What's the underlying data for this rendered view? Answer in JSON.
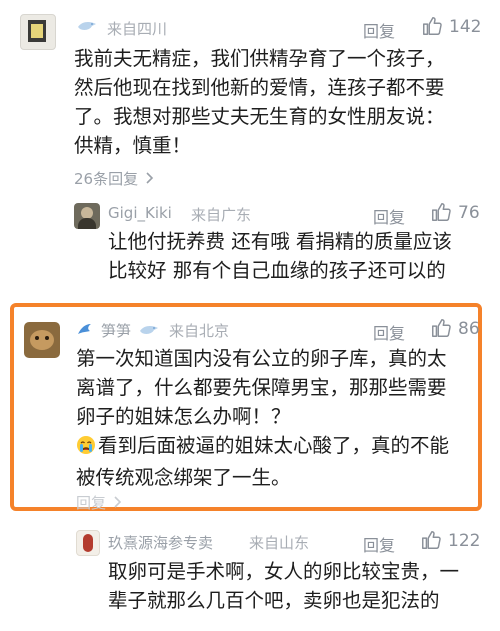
{
  "comments": [
    {
      "location": "来自四川",
      "reply_label": "回复",
      "likes": "142",
      "body_lines": [
        "我前夫无精症，我们供精孕育了一个孩子，",
        "然后他现在找到他新的爱情，连孩子都不要",
        "了。我想对那些丈夫无生育的女性朋友说：",
        "供精，慎重！"
      ],
      "more_replies": "26条回复"
    },
    {
      "username": "Gigi_Kiki",
      "location": "来自广东",
      "reply_label": "回复",
      "likes": "76",
      "body_lines": [
        "让他付抚养费 还有哦 看捐精的质量应该",
        "比较好 那有个自己血缘的孩子还可以的"
      ]
    },
    {
      "username": "笋笋",
      "location": "来自北京",
      "reply_label": "回复",
      "likes": "86",
      "body_lines": [
        "第一次知道国内没有公立的卵子库，真的太",
        "离谱了，什么都要先保障男宝，那那些需要",
        "卵子的姐妹怎么办啊！？",
        "看到后面被逼的姐妹太心酸了，真的不能",
        "被传统观念绑架了一生。"
      ],
      "more_replies": "回复"
    },
    {
      "username": "玖熹源海参专卖",
      "location": "来自山东",
      "reply_label": "回复",
      "likes": "122",
      "body_lines": [
        "取卵可是手术啊，女人的卵比较宝贵，一",
        "辈子就那么几百个吧，卖卵也是犯法的"
      ]
    }
  ],
  "colors": {
    "highlight": "#f5822a",
    "meta": "#9aa0a8",
    "text": "#1e1e1e"
  },
  "icons": [
    "thumbs-up-icon",
    "chevron-right-icon",
    "crying-face-icon",
    "bird-badge-icon"
  ]
}
